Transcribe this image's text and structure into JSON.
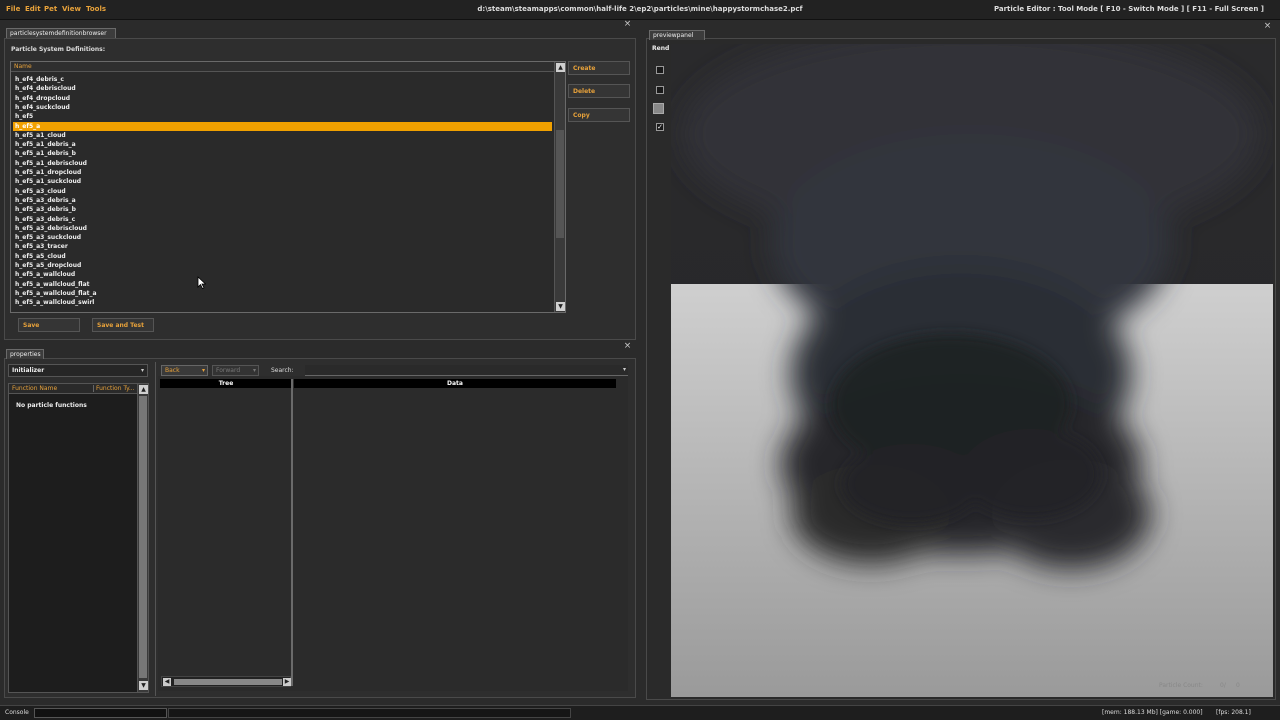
{
  "menubar": {
    "items": [
      "File",
      "Edit",
      "Pet",
      "View",
      "Tools"
    ],
    "file_path": "d:\\steam\\steamapps\\common\\half-life 2\\ep2\\particles\\mine\\happystormchase2.pcf",
    "mode_text": "Particle Editor : Tool Mode [ F10 - Switch Mode ] [ F11 - Full Screen ]"
  },
  "browser": {
    "tab": "particlesystemdefinitionbrowser",
    "heading": "Particle System Definitions:",
    "column_name": "Name",
    "items": [
      "h_ef4_debris_c",
      "h_ef4_debriscloud",
      "h_ef4_dropcloud",
      "h_ef4_suckcloud",
      "h_ef5",
      "h_ef5_a",
      "h_ef5_a1_cloud",
      "h_ef5_a1_debris_a",
      "h_ef5_a1_debris_b",
      "h_ef5_a1_debriscloud",
      "h_ef5_a1_dropcloud",
      "h_ef5_a1_suckcloud",
      "h_ef5_a3_cloud",
      "h_ef5_a3_debris_a",
      "h_ef5_a3_debris_b",
      "h_ef5_a3_debris_c",
      "h_ef5_a3_debriscloud",
      "h_ef5_a3_suckcloud",
      "h_ef5_a3_tracer",
      "h_ef5_a5_cloud",
      "h_ef5_a5_dropcloud",
      "h_ef5_a_wallcloud",
      "h_ef5_a_wallcloud_flat",
      "h_ef5_a_wallcloud_flat_a",
      "h_ef5_a_wallcloud_swirl"
    ],
    "buttons": {
      "create": "Create",
      "delete": "Delete",
      "copy": "Copy",
      "save": "Save",
      "save_and_test": "Save and Test"
    }
  },
  "properties": {
    "tab": "properties",
    "type_select": "Initializer",
    "col_function_name": "Function Name",
    "col_function_type": "Function Ty...",
    "empty_text": "No particle functions",
    "back": "Back",
    "forward": "Forward",
    "search_label": "Search:",
    "col_tree": "Tree",
    "col_data": "Data"
  },
  "preview": {
    "tab": "previewpanel",
    "mode_label": "Rend",
    "particle_count_label": "Particle Count:",
    "particle_count_value": "0/",
    "particle_count_max": "0"
  },
  "status": {
    "console": "Console",
    "mem": "[mem: 188.13 Mb] [game: 0.000]",
    "fps": "[fps: 208.1]"
  },
  "colors": {
    "accent": "#f0a000",
    "label_orange": "#e8a23a",
    "background": "#2b2b2b"
  }
}
